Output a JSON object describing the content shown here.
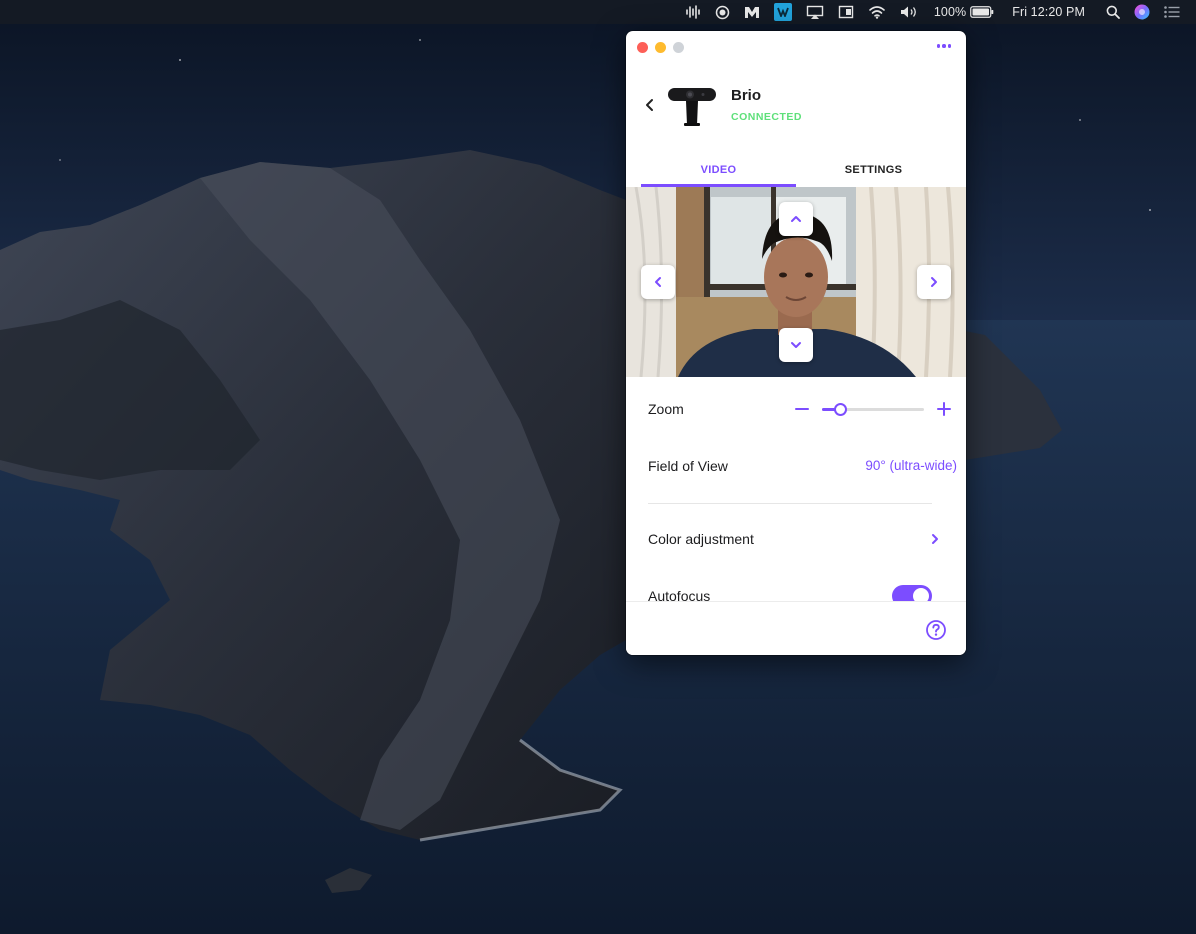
{
  "menubar": {
    "icons": [
      "audio-waveform-icon",
      "record-icon",
      "m-app-icon",
      "logi-app-icon",
      "airplay-icon",
      "display-icon",
      "wifi-icon",
      "volume-icon",
      "battery-icon",
      "spotlight-search-icon",
      "siri-icon",
      "notification-center-icon"
    ],
    "battery_percent": "100%",
    "clock": "Fri 12:20 PM"
  },
  "window": {
    "device_name": "Brio",
    "device_status": "CONNECTED",
    "tabs": [
      {
        "label": "VIDEO",
        "active": true
      },
      {
        "label": "SETTINGS",
        "active": false
      }
    ],
    "preview_controls": [
      "pan-up-icon",
      "pan-down-icon",
      "pan-left-icon",
      "pan-right-icon"
    ],
    "zoom": {
      "label": "Zoom",
      "level": 0.18
    },
    "field_of_view": {
      "label": "Field of View",
      "value": "90° (ultra-wide)"
    },
    "color_adjustment": {
      "label": "Color adjustment"
    },
    "autofocus": {
      "label": "Autofocus",
      "enabled": true
    },
    "help_icon": "help-circle-icon"
  },
  "colors": {
    "accent": "#7c4dff",
    "connected": "#5ee07a",
    "menubar": "#141a24"
  }
}
